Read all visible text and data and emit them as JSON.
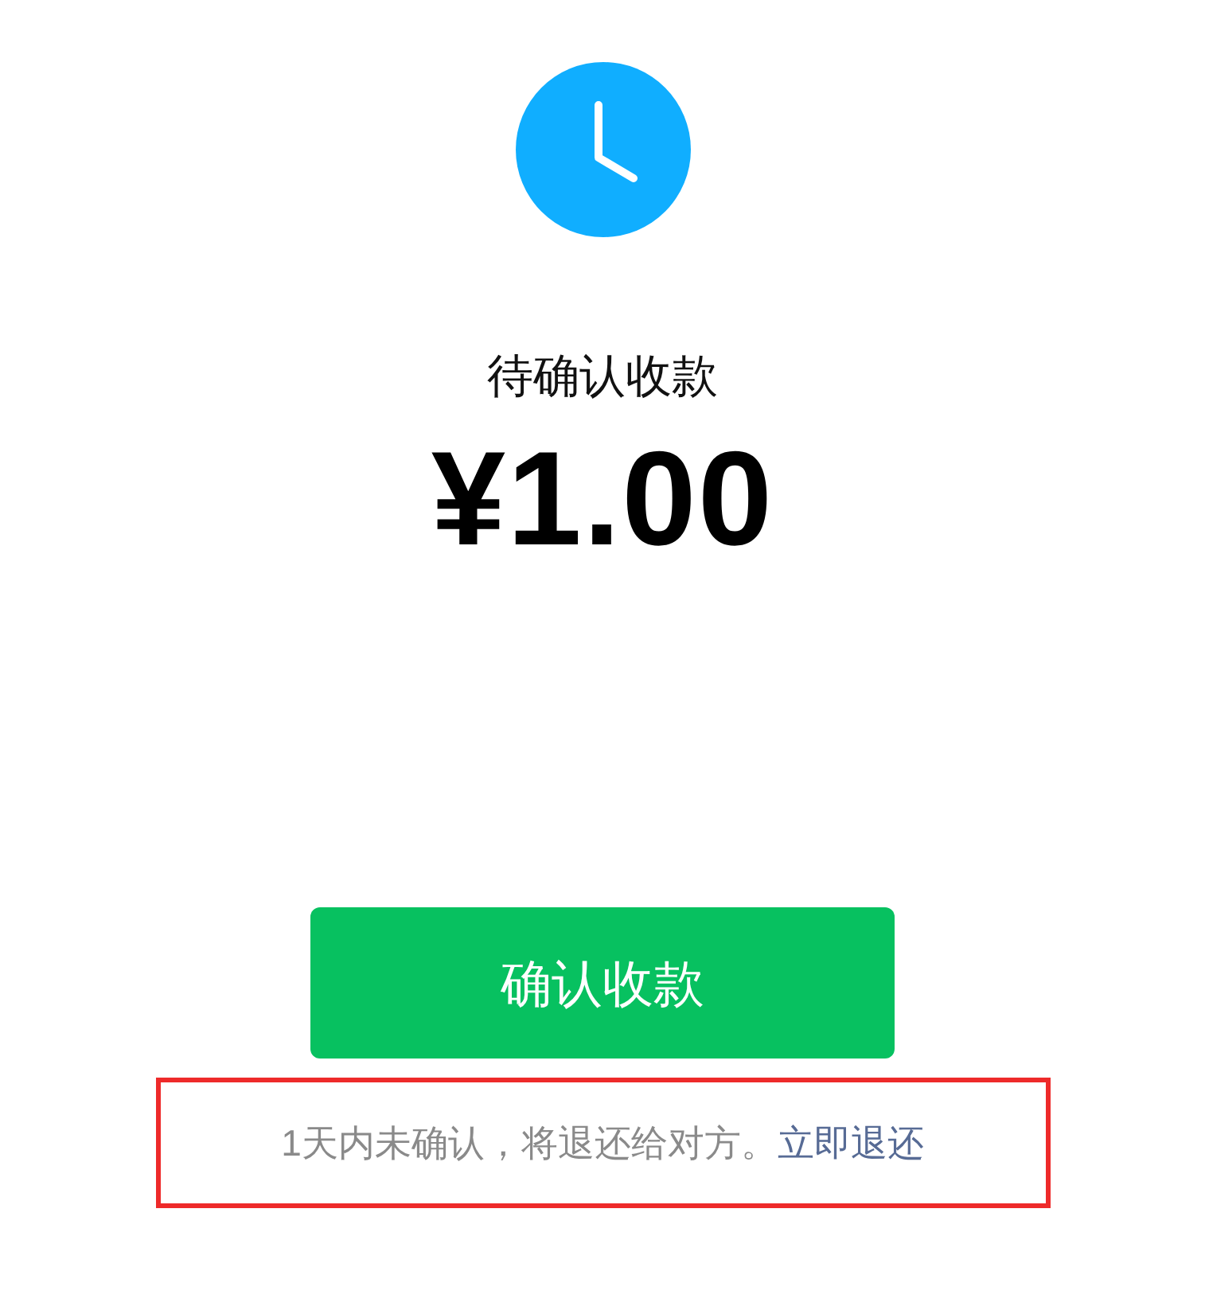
{
  "status_title": "待确认收款",
  "amount": "¥1.00",
  "confirm_button": "确认收款",
  "notice": {
    "text": "1天内未确认，将退还给对方。",
    "link": "立即退还",
    "highlighted": true
  }
}
